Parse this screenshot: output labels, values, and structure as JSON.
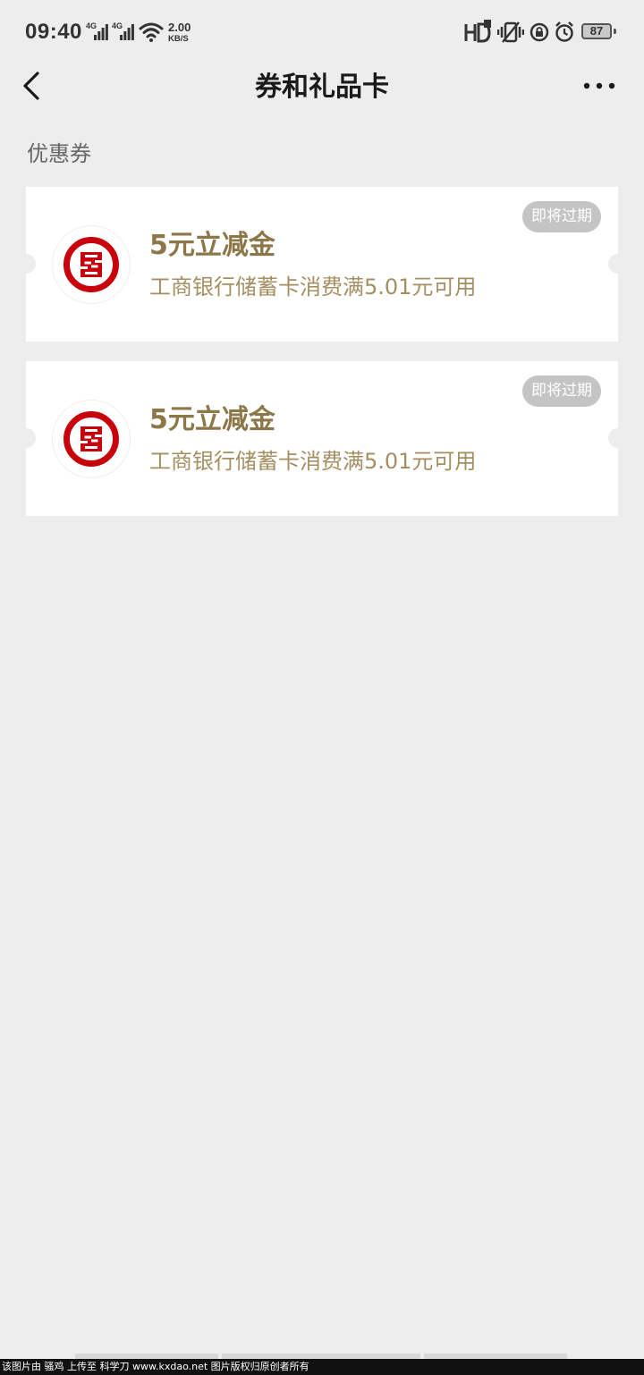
{
  "status_bar": {
    "time": "09:40",
    "signal_1": "4G",
    "signal_2": "4G",
    "net_speed_value": "2.00",
    "net_speed_unit": "KB/S",
    "battery": "87",
    "icons": [
      "signal-4g-icon",
      "signal-4g-icon",
      "wifi-icon",
      "hd-icon",
      "vibrate-icon",
      "rotation-lock-icon",
      "alarm-icon",
      "battery-icon"
    ]
  },
  "nav": {
    "title": "券和礼品卡",
    "back_icon": "chevron-left-icon",
    "more_icon": "more-dots-icon"
  },
  "section": {
    "title": "优惠券"
  },
  "coupons": [
    {
      "title": "5元立减金",
      "description": "工商银行储蓄卡消费满5.01元可用",
      "badge": "即将过期",
      "logo": "icbc-logo"
    },
    {
      "title": "5元立减金",
      "description": "工商银行储蓄卡消费满5.01元可用",
      "badge": "即将过期",
      "logo": "icbc-logo"
    }
  ],
  "colors": {
    "background": "#ededed",
    "coupon_title": "#8c7748",
    "coupon_desc": "#a58f62",
    "badge_bg": "#c4c4c4",
    "icbc_red": "#c7000b"
  },
  "watermark": {
    "text": "该图片由 骚鸡 上传至 科学刀 www.kxdao.net 图片版权归原创者所有"
  }
}
